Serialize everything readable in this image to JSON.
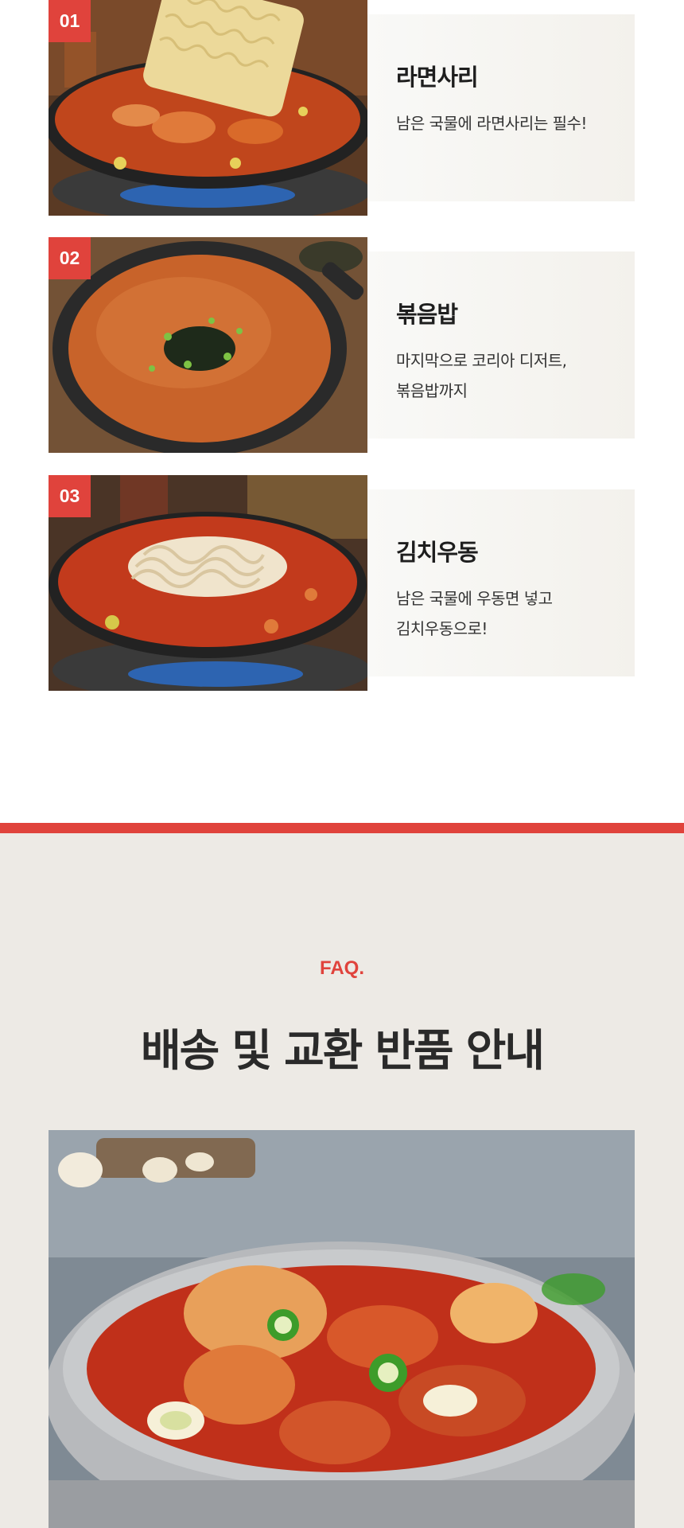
{
  "items": [
    {
      "number": "01",
      "title": "라면사리",
      "desc_lines": [
        "남은 국물에 라면사리는 필수!"
      ]
    },
    {
      "number": "02",
      "title": "볶음밥",
      "desc_lines": [
        "마지막으로 코리아 디저트,",
        "볶음밥까지"
      ]
    },
    {
      "number": "03",
      "title": "김치우동",
      "desc_lines": [
        "남은 국물에 우동면 넣고",
        "김치우동으로!"
      ]
    }
  ],
  "faq": {
    "label": "FAQ.",
    "title": "배송 및 교환 반품 안내"
  },
  "colors": {
    "accent": "#e0433c",
    "faq_background": "#edeae5",
    "card_background": "#f5f3ef"
  }
}
